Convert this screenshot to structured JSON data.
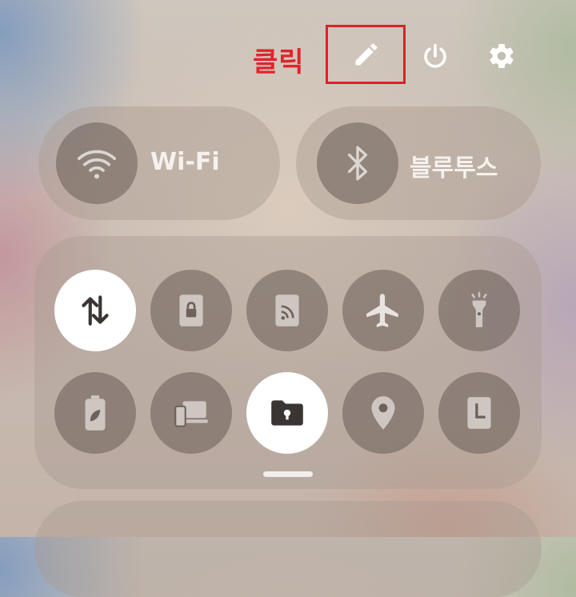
{
  "annotation": {
    "label": "클릭"
  },
  "top_bar": {
    "edit_icon": "pencil-icon",
    "power_icon": "power-icon",
    "settings_icon": "gear-icon"
  },
  "pills": [
    {
      "label": "Wi-Fi",
      "icon": "wifi-icon"
    },
    {
      "label": "블루투스",
      "icon": "bluetooth-icon"
    }
  ],
  "quick_tiles": [
    {
      "icon": "mobile-data-icon",
      "active": true
    },
    {
      "icon": "lock-screen-icon",
      "active": false
    },
    {
      "icon": "cast-icon",
      "active": false
    },
    {
      "icon": "airplane-icon",
      "active": false
    },
    {
      "icon": "flashlight-icon",
      "active": false
    },
    {
      "icon": "battery-saver-icon",
      "active": false
    },
    {
      "icon": "devices-icon",
      "active": false
    },
    {
      "icon": "secure-folder-icon",
      "active": true
    },
    {
      "icon": "location-icon",
      "active": false
    },
    {
      "icon": "clock-icon",
      "active": false
    }
  ],
  "colors": {
    "annotation": "#e2232b",
    "tile_active_bg": "#ffffff",
    "tile_active_icon": "#3a3532",
    "tile_icon": "#f2eeea"
  }
}
